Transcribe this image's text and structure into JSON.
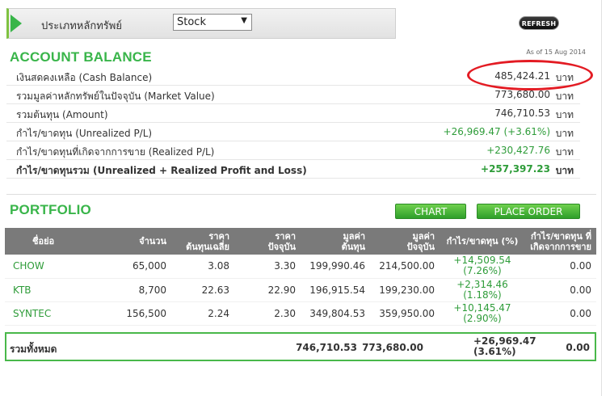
{
  "filter": {
    "label": "ประเภทหลักทรัพย์",
    "selected": "Stock",
    "caret": "▼"
  },
  "refresh_label": "REFRESH",
  "as_of": "As of 15 Aug 2014",
  "account_balance": {
    "title": "ACCOUNT BALANCE",
    "rows": [
      {
        "label": "เงินสดคงเหลือ (Cash Balance)",
        "value": "485,424.21",
        "unit": "บาท"
      },
      {
        "label": "รวมมูลค่าหลักทรัพย์ในปัจจุบัน (Market Value)",
        "value": "773,680.00",
        "unit": "บาท"
      },
      {
        "label": "รวมต้นทุน (Amount)",
        "value": "746,710.53",
        "unit": "บาท"
      },
      {
        "label": "กำไร/ขาดทุน (Unrealized P/L)",
        "value": "+26,969.47 (+3.61%)",
        "unit": "บาท"
      },
      {
        "label": "กำไร/ขาดทุนที่เกิดจากการขาย (Realized P/L)",
        "value": "+230,427.76",
        "unit": "บาท"
      },
      {
        "label": "กำไร/ขาดทุนรวม (Unrealized + Realized Profit and Loss)",
        "value": "+257,397.23",
        "unit": "บาท"
      }
    ]
  },
  "portfolio": {
    "title": "PORTFOLIO",
    "chart_label": "CHART",
    "place_order_label": "PLACE ORDER",
    "headers": {
      "symbol": "ชื่อย่อ",
      "volume": "จำนวน",
      "avg_cost_1": "ราคา",
      "avg_cost_2": "ต้นทุนเฉลี่ย",
      "price_1": "ราคา",
      "price_2": "ปัจจุบัน",
      "cost_1": "มูลค่า",
      "cost_2": "ต้นทุน",
      "mv_1": "มูลค่า",
      "mv_2": "ปัจจุบัน",
      "upl": "กำไร/ขาดทุน (%)",
      "rpl_1": "กำไร/ขาดทุน ที่",
      "rpl_2": "เกิดจากการขาย"
    },
    "rows": [
      {
        "symbol": "CHOW",
        "volume": "65,000",
        "avg_cost": "3.08",
        "price": "3.30",
        "cost": "199,990.46",
        "market_value": "214,500.00",
        "upl": "+14,509.54",
        "upl_pct": "(7.26%)",
        "rpl": "0.00"
      },
      {
        "symbol": "KTB",
        "volume": "8,700",
        "avg_cost": "22.63",
        "price": "22.90",
        "cost": "196,915.54",
        "market_value": "199,230.00",
        "upl": "+2,314.46",
        "upl_pct": "(1.18%)",
        "rpl": "0.00"
      },
      {
        "symbol": "SYNTEC",
        "volume": "156,500",
        "avg_cost": "2.24",
        "price": "2.30",
        "cost": "349,804.53",
        "market_value": "359,950.00",
        "upl": "+10,145.47",
        "upl_pct": "(2.90%)",
        "rpl": "0.00"
      }
    ],
    "total": {
      "label": "รวมทั้งหมด",
      "cost": "746,710.53",
      "market_value": "773,680.00",
      "upl": "+26,969.47",
      "upl_pct": "(3.61%)",
      "rpl": "0.00"
    }
  },
  "colors": {
    "accent_green": "#39b54a",
    "highlight_red": "#e31b23",
    "header_gray": "#7a7a7a"
  }
}
